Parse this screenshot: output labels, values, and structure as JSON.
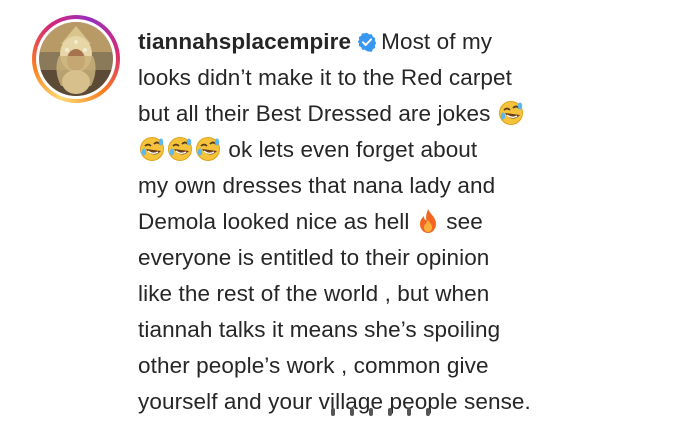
{
  "post": {
    "username": "tiannahsplacempire",
    "verified_icon": "verified-badge-icon",
    "accent_color": "#3897f0",
    "caption": {
      "line1": "Most of my",
      "line2": "looks didn’t make it to the Red carpet",
      "line3": "but all their Best Dressed are jokes",
      "line4": "ok lets even forget about",
      "line5": "my own dresses that nana lady and",
      "line6": "Demola looked nice as hell",
      "line6b": "see",
      "line7": "everyone is entitled to their opinion",
      "line8": "like the rest of the world , but when",
      "line9": "tiannah talks it means she’s spoiling",
      "line10": "other people’s work , common give",
      "line11": "yourself and your village people sense."
    },
    "emojis": {
      "laugh": "rolling-on-floor-laughing-emoji",
      "fire": "fire-emoji"
    }
  }
}
